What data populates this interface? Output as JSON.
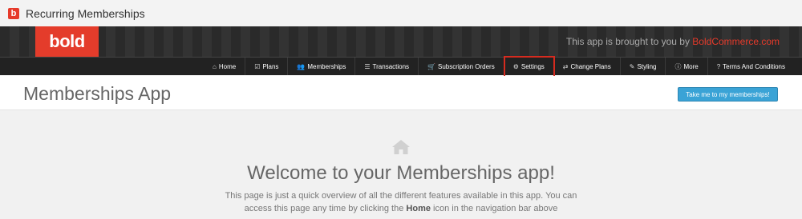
{
  "window": {
    "title": "Recurring Memberships",
    "icon_letter": "b"
  },
  "header": {
    "logo_text": "bold",
    "brought_prefix": "This app is brought to you by ",
    "brought_link": "BoldCommerce.com"
  },
  "nav": {
    "items": [
      {
        "label": "Home",
        "icon": "home-icon"
      },
      {
        "label": "Plans",
        "icon": "checkbox-icon"
      },
      {
        "label": "Memberships",
        "icon": "users-icon"
      },
      {
        "label": "Transactions",
        "icon": "list-icon"
      },
      {
        "label": "Subscription Orders",
        "icon": "cart-icon"
      },
      {
        "label": "Settings",
        "icon": "gears-icon",
        "highlighted": true
      },
      {
        "label": "Change Plans",
        "icon": "exchange-icon"
      },
      {
        "label": "Styling",
        "icon": "brush-icon"
      },
      {
        "label": "More",
        "icon": "info-icon"
      },
      {
        "label": "Terms And Conditions",
        "icon": "question-icon"
      }
    ]
  },
  "page": {
    "title": "Memberships App",
    "cta_label": "Take me to my memberships!"
  },
  "content": {
    "welcome": "Welcome to your Memberships app!",
    "intro_1": "This page is just a quick overview of all the different features available in this app. You can access this page any time by clicking the ",
    "intro_bold": "Home",
    "intro_2": " icon in the navigation bar above"
  },
  "colors": {
    "brand_red": "#e43c2b",
    "highlight_red": "#d62b1f",
    "cta_blue": "#3aa3d6"
  }
}
